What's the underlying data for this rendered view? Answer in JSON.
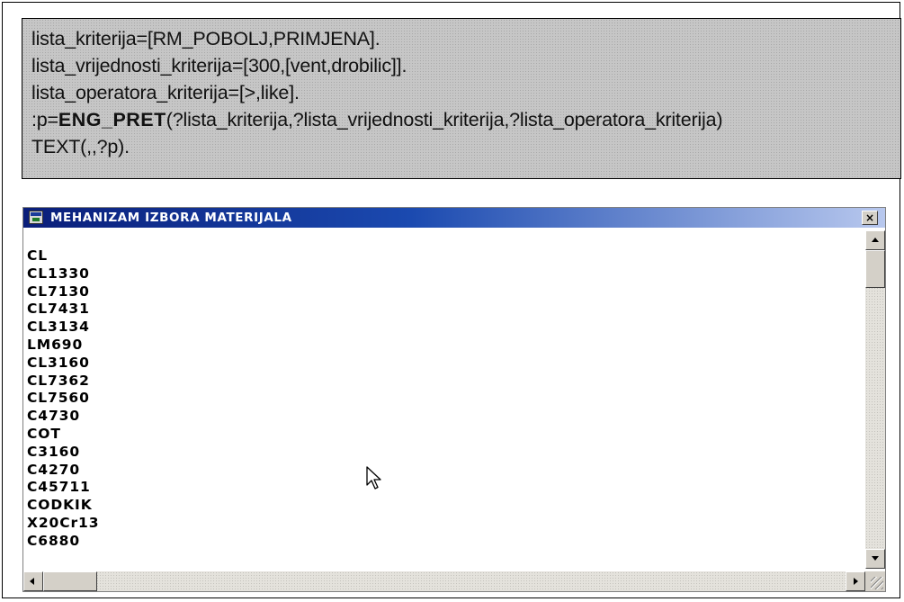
{
  "code": {
    "lines": [
      "lista_kriterija=[RM_POBOLJ,PRIMJENA].",
      "lista_vrijednosti_kriterija=[300,[vent,drobilic]].",
      "lista_operatora_kriterija=[>,like]."
    ],
    "call": {
      "prefix": ":p=",
      "function": "ENG_PRET",
      "args": "(?lista_kriterija,?lista_vrijednosti_kriterija,?lista_operatora_kriterija)"
    },
    "last_line": "TEXT(,,?p)."
  },
  "window": {
    "title": "MEHANIZAM IZBORA MATERIJALA",
    "close_symbol": "×",
    "items": [
      "CL",
      "CL1330",
      "CL7130",
      "CL7431",
      "CL3134",
      "LM690",
      "CL3160",
      "CL7362",
      "CL7560",
      "C4730",
      "COT",
      "C3160",
      "C4270",
      "C45711",
      "CODKIK",
      "X20Cr13",
      "C6880"
    ]
  },
  "icons": [
    "window-app-icon",
    "close-icon",
    "scroll-up-icon",
    "scroll-down-icon",
    "scroll-left-icon",
    "scroll-right-icon",
    "mouse-pointer-icon",
    "size-grip-icon"
  ]
}
